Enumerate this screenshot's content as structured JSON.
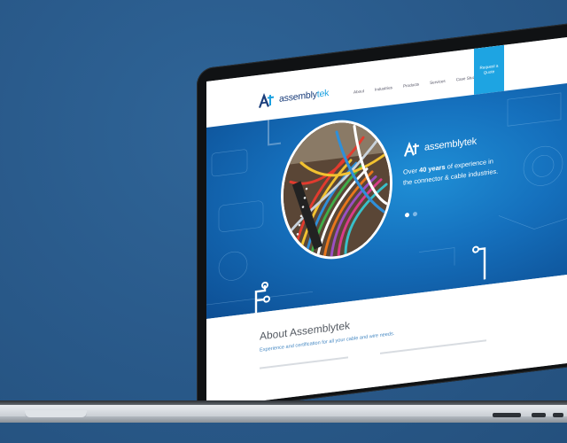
{
  "site": {
    "logo_prefix": "assembly",
    "logo_suffix": "tek",
    "nav": [
      {
        "label": "About"
      },
      {
        "label": "Industries"
      },
      {
        "label": "Products"
      },
      {
        "label": "Services"
      },
      {
        "label": "Case Studies"
      }
    ],
    "quote_button": "Request a Quote"
  },
  "hero": {
    "logo_prefix": "assembly",
    "logo_suffix": "tek",
    "text_before": "Over ",
    "text_bold": "40 years",
    "text_after": " of experience in the connector & cable industries.",
    "slide_count": 2,
    "active_slide": 1
  },
  "about": {
    "title": "About Assemblytek",
    "subtitle": "Experience and certification for all your cable and wire needs."
  },
  "colors": {
    "background": "#2a5b8c",
    "accent": "#1ea4e2",
    "brand_dark": "#1a3d7a"
  }
}
